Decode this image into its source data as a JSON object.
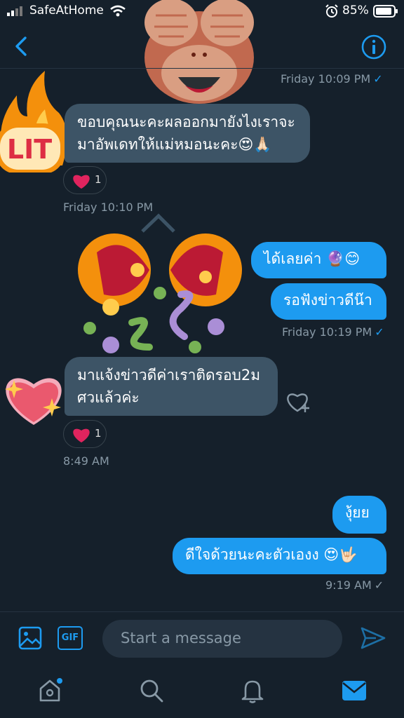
{
  "status_bar": {
    "carrier": "SafeAtHome",
    "battery": "85%"
  },
  "colors": {
    "accent": "#1d9bf0",
    "background": "#15202b",
    "received_bubble": "#3d5466",
    "reaction_heart": "#e0245e"
  },
  "messages": [
    {
      "id": "m1",
      "direction": "received",
      "lines": [
        "ขอบคุณนะคะผลออกมายังไงเราจะ",
        "มาอัพเดทให้แม่หมอนะคะ😍🙏🏻"
      ],
      "reaction_count": "1",
      "time": "Friday 10:10 PM"
    },
    {
      "id": "m2",
      "direction": "sent",
      "text": "ได้เลยค่า 🔮😊"
    },
    {
      "id": "m3",
      "direction": "sent",
      "text": "รอฟังข่าวดีน๊า",
      "time": "Friday 10:19 PM"
    },
    {
      "id": "m4",
      "direction": "received",
      "lines": [
        "มาแจ้งข่าวดีค่าเราติดรอบ2ม",
        "ศวแล้วค่ะ"
      ],
      "reaction_count": "1",
      "time": "8:49 AM"
    },
    {
      "id": "m5",
      "direction": "sent",
      "text": "งุ้ยย"
    },
    {
      "id": "m6",
      "direction": "sent",
      "text": "ดีใจด้วยนะคะตัวเองง 😍🤟🏻",
      "time": "9:19 AM"
    }
  ],
  "top_time": "Friday 10:09 PM",
  "decorations": {
    "lit_sticker": "LIT"
  },
  "composer": {
    "placeholder": "Start a message"
  },
  "icons": {
    "back": "chevron-left-icon",
    "info": "info-icon",
    "image": "image-icon",
    "gif": "gif-icon",
    "gif_text": "GIF",
    "send": "send-icon",
    "home": "home-icon",
    "search": "search-icon",
    "notifications": "bell-icon",
    "messages": "mail-icon",
    "add_reaction": "add-reaction-icon"
  }
}
